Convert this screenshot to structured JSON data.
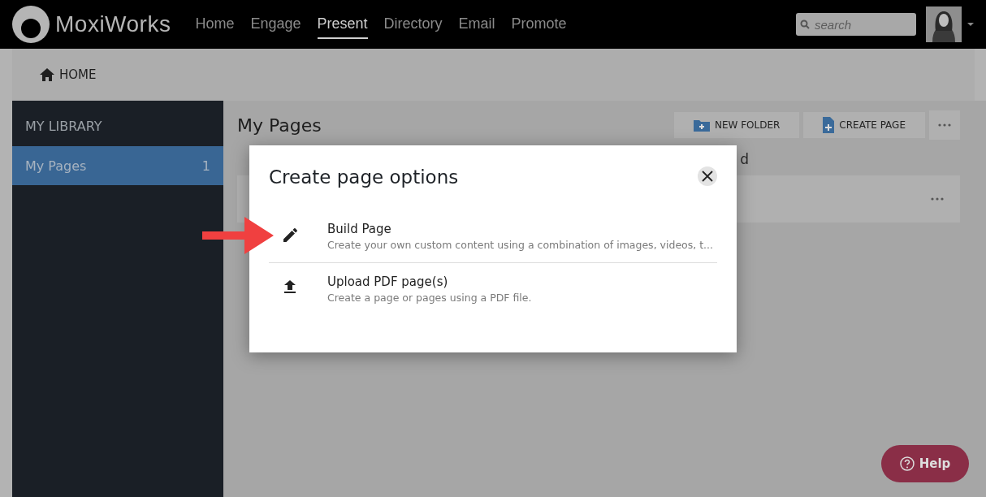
{
  "header": {
    "logo": "MoxiWorks",
    "nav": [
      {
        "label": "Home",
        "selected": false
      },
      {
        "label": "Engage",
        "selected": false
      },
      {
        "label": "Present",
        "selected": true
      },
      {
        "label": "Directory",
        "selected": false
      },
      {
        "label": "Email",
        "selected": false
      },
      {
        "label": "Promote",
        "selected": false
      }
    ],
    "search": {
      "placeholder": "search"
    }
  },
  "breadcrumb": "HOME",
  "sidebar": {
    "title": "MY LIBRARY",
    "items": [
      {
        "label": "My Pages",
        "count": "1",
        "selected": true
      }
    ]
  },
  "main": {
    "title": "My Pages",
    "buttons": [
      {
        "label": "NEW FOLDER",
        "kind": "folder"
      },
      {
        "label": "CREATE PAGE",
        "kind": "page"
      }
    ],
    "partial_text": "d"
  },
  "modal": {
    "title": "Create page options",
    "options": [
      {
        "kind": "edit",
        "title": "Build Page",
        "description": "Create your own custom content using a combination of images, videos, t...",
        "pointed": true
      },
      {
        "kind": "upload",
        "title": "Upload PDF page(s)",
        "description": "Create a page or pages using a PDF file.",
        "pointed": false
      }
    ]
  },
  "help": "Help"
}
